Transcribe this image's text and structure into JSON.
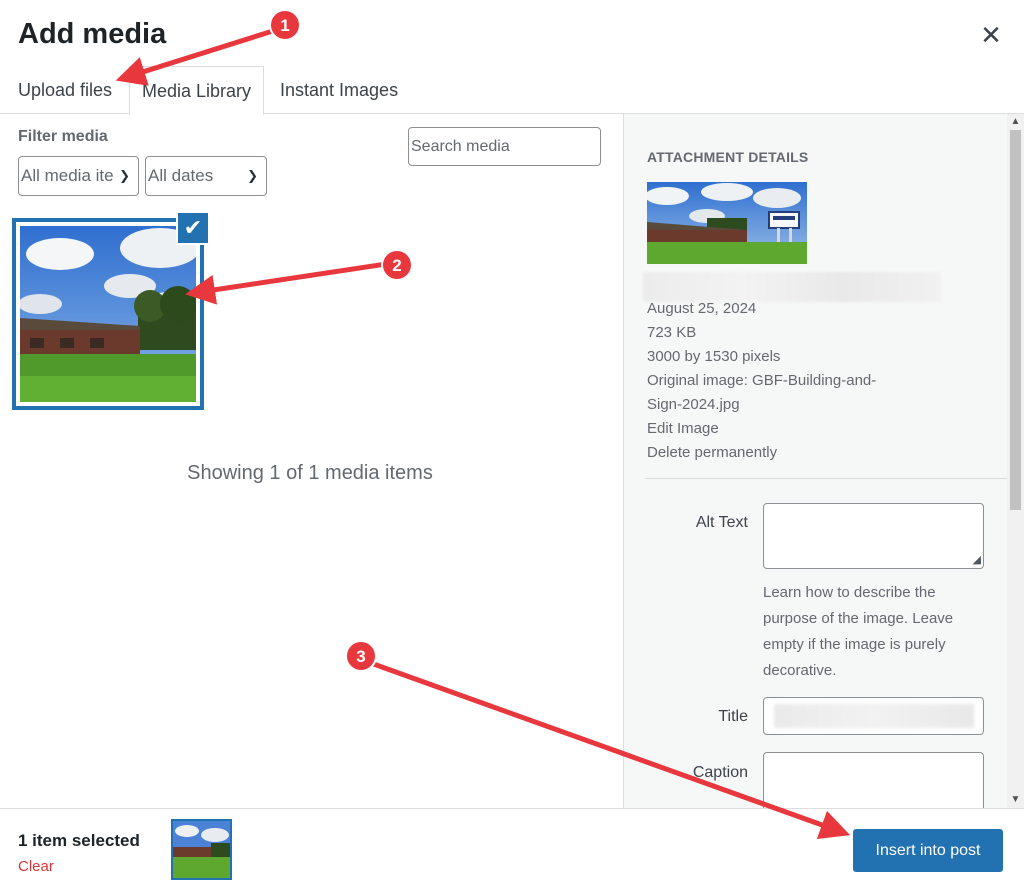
{
  "modal": {
    "title": "Add media"
  },
  "tabs": [
    {
      "label": "Upload files"
    },
    {
      "label": "Media Library",
      "active": true
    },
    {
      "label": "Instant Images"
    }
  ],
  "filter": {
    "label": "Filter media",
    "type_selected": "All media ite",
    "date_selected": "All dates",
    "search_placeholder": "Search media"
  },
  "library": {
    "showing": "Showing 1 of 1 media items",
    "selected_check": "✔"
  },
  "attachment": {
    "heading": "ATTACHMENT DETAILS",
    "date": "August 25, 2024",
    "size": "723 KB",
    "dimensions": "3000 by 1530 pixels",
    "original_line1": "Original image: GBF-Building-and-",
    "original_line2": "Sign-2024.jpg",
    "edit": "Edit Image",
    "delete": "Delete permanently",
    "alt_label": "Alt Text",
    "alt_help": "Learn how to describe the purpose of the image. Leave empty if the image is purely decorative.",
    "title_label": "Title",
    "caption_label": "Caption"
  },
  "footer": {
    "selected": "1 item selected",
    "clear": "Clear",
    "insert": "Insert into post"
  },
  "annotations": [
    "1",
    "2",
    "3"
  ],
  "colors": {
    "accent": "#2271b1",
    "danger": "#d63638",
    "arrow": "#e8383d"
  }
}
